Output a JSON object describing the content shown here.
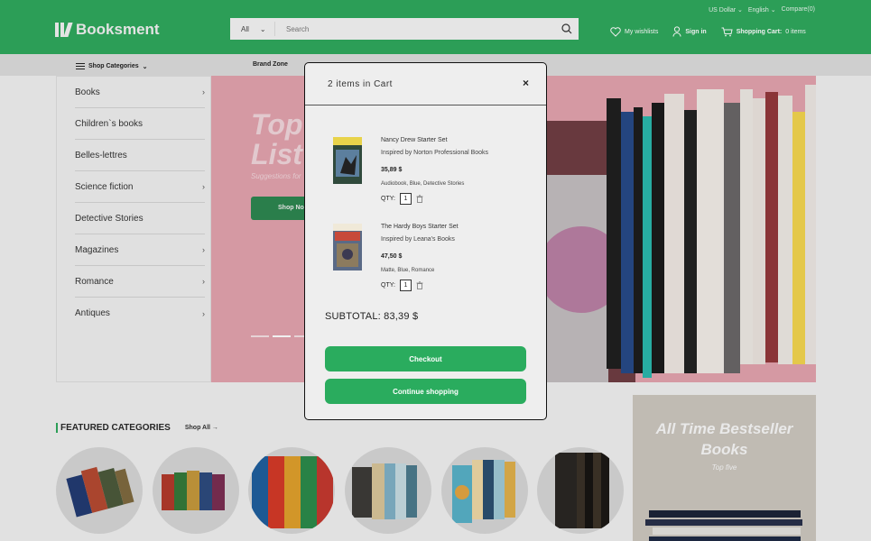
{
  "header": {
    "brand": "Booksment",
    "search": {
      "category": "All",
      "placeholder": "Search"
    },
    "top_links": [
      "US Dollar",
      "English",
      "Compare(0)"
    ],
    "wishlist_label": "My wishlists",
    "signin_label": "Sign in",
    "cart_label": "Shopping Cart:",
    "cart_count": "0 items"
  },
  "nav": {
    "shop_categories": "Shop Categories",
    "brand_zone": "Brand Zone"
  },
  "sidebar": {
    "items": [
      {
        "label": "Books",
        "chevron": true
      },
      {
        "label": "Children`s books",
        "chevron": false
      },
      {
        "label": "Belles-lettres",
        "chevron": false
      },
      {
        "label": "Science fiction",
        "chevron": true
      },
      {
        "label": "Detective Stories",
        "chevron": false
      },
      {
        "label": "Magazines",
        "chevron": true
      },
      {
        "label": "Romance",
        "chevron": true
      },
      {
        "label": "Antiques",
        "chevron": true
      }
    ]
  },
  "hero": {
    "title_line1": "Top",
    "title_line2": "List",
    "subtitle": "Suggestions for",
    "button": "Shop No"
  },
  "featured": {
    "title": "FEATURED CATEGORIES",
    "shop_all": "Shop All →"
  },
  "bestseller": {
    "title": "All Time Bestseller Books",
    "subtitle": "Top five"
  },
  "cart_modal": {
    "title": "2 items in Cart",
    "close": "×",
    "items": [
      {
        "title": "Nancy Drew Starter Set",
        "brand": "Inspired by Norton Professional Books",
        "price": "35,89 $",
        "attributes": "Audiobook, Blue, Detective Stories",
        "qty_label": "QTY:",
        "qty": "1"
      },
      {
        "title": "The Hardy Boys Starter Set",
        "brand": "Inspired by Leana's Books",
        "price": "47,50 $",
        "attributes": "Matte, Blue, Romance",
        "qty_label": "QTY:",
        "qty": "1"
      }
    ],
    "subtotal": "SUBTOTAL: 83,39 $",
    "checkout": "Checkout",
    "continue": "Continue shopping"
  },
  "colors": {
    "brand_green": "#2fa85d",
    "button_green": "#2aac5e",
    "hero_pink": "#e3a3ae"
  }
}
